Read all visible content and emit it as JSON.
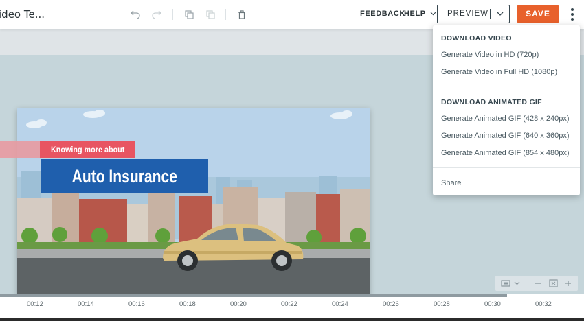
{
  "header": {
    "title": "ideo Te...",
    "feedback_label": "FEEDBACK",
    "help_label": "HELP",
    "preview_label": "PREVIEW",
    "save_label": "SAVE"
  },
  "icons": {
    "undo": "undo-icon",
    "redo": "redo-icon",
    "copy": "copy-icon",
    "paste": "paste-icon",
    "delete": "trash-icon",
    "more": "more-vertical-icon"
  },
  "colors": {
    "save_button": "#e8612c",
    "banner_red": "#e85562",
    "banner_blue": "#1f5fad",
    "car": "#dcc07f"
  },
  "scene": {
    "banner_top": "Knowing more about",
    "banner_main": "Auto Insurance"
  },
  "timeline": {
    "ticks": [
      "00:12",
      "00:14",
      "00:16",
      "00:18",
      "00:20",
      "00:22",
      "00:24",
      "00:26",
      "00:28",
      "00:30",
      "00:32"
    ]
  },
  "menu": {
    "video_heading": "DOWNLOAD VIDEO",
    "video_items": [
      "Generate Video in HD (720p)",
      "Generate Video in Full HD (1080p)"
    ],
    "gif_heading": "DOWNLOAD ANIMATED GIF",
    "gif_items": [
      "Generate Animated GIF (428 x 240px)",
      "Generate Animated GIF (640 x 360px)",
      "Generate Animated GIF (854 x 480px)"
    ],
    "share_label": "Share"
  }
}
